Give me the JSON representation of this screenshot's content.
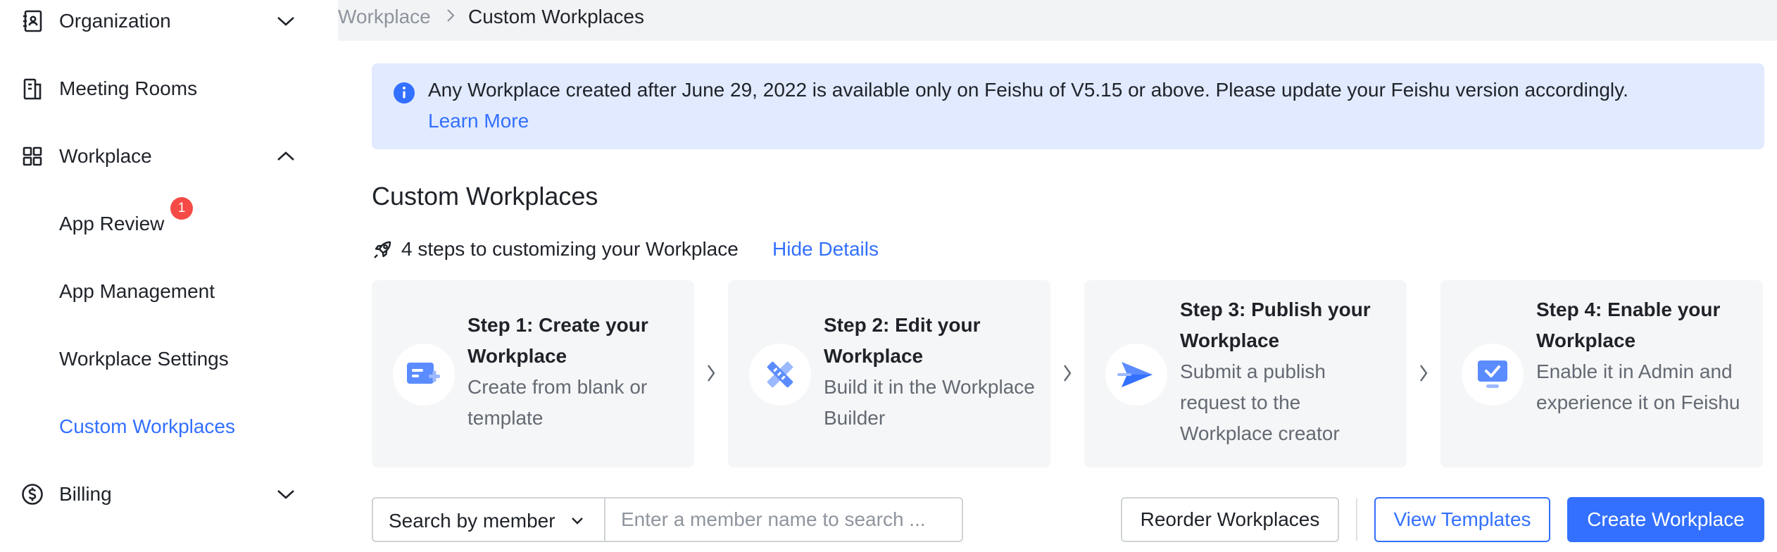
{
  "sidebar": {
    "items": [
      {
        "label": "Organization",
        "icon": "contacts-book-icon",
        "chevron": "chevron-down-icon"
      },
      {
        "label": "Meeting Rooms",
        "icon": "building-icon"
      },
      {
        "label": "Workplace",
        "icon": "app-grid-icon",
        "chevron": "chevron-up-icon"
      },
      {
        "label": "Billing",
        "icon": "dollar-circle-icon",
        "chevron": "chevron-down-icon"
      }
    ],
    "workplace_subitems": [
      {
        "label": "App Review",
        "badge": "1"
      },
      {
        "label": "App Management"
      },
      {
        "label": "Workplace Settings"
      },
      {
        "label": "Custom Workplaces",
        "active": true
      }
    ]
  },
  "breadcrumb": {
    "parent": "Workplace",
    "current": "Custom Workplaces"
  },
  "notice": {
    "text": "Any Workplace created after June 29, 2022 is available only on Feishu of V5.15 or above. Please update your Feishu version accordingly.",
    "link": "Learn More"
  },
  "main": {
    "title": "Custom Workplaces",
    "steps_header": "4 steps to customizing your Workplace",
    "hide_details": "Hide Details",
    "steps": [
      {
        "title": "Step 1: Create your Workplace",
        "desc": "Create from blank or template",
        "icon": "create-card-icon"
      },
      {
        "title": "Step 2: Edit your Workplace",
        "desc": "Build it in the Workplace Builder",
        "icon": "pencil-ruler-icon"
      },
      {
        "title": "Step 3: Publish your Workplace",
        "desc": "Submit a publish request to the Workplace creator",
        "icon": "paper-plane-icon"
      },
      {
        "title": "Step 4: Enable your Workplace",
        "desc": "Enable it in Admin and experience it on Feishu",
        "icon": "monitor-check-icon"
      }
    ]
  },
  "toolbar": {
    "search_by": "Search by member",
    "search_placeholder": "Enter a member name to search ...",
    "reorder": "Reorder Workplaces",
    "view_templates": "View Templates",
    "create": "Create Workplace"
  },
  "colors": {
    "accent": "#3370ff",
    "notice_bg": "#e1eaff",
    "badge": "#f54a45",
    "page_bg": "#f2f3f5"
  }
}
